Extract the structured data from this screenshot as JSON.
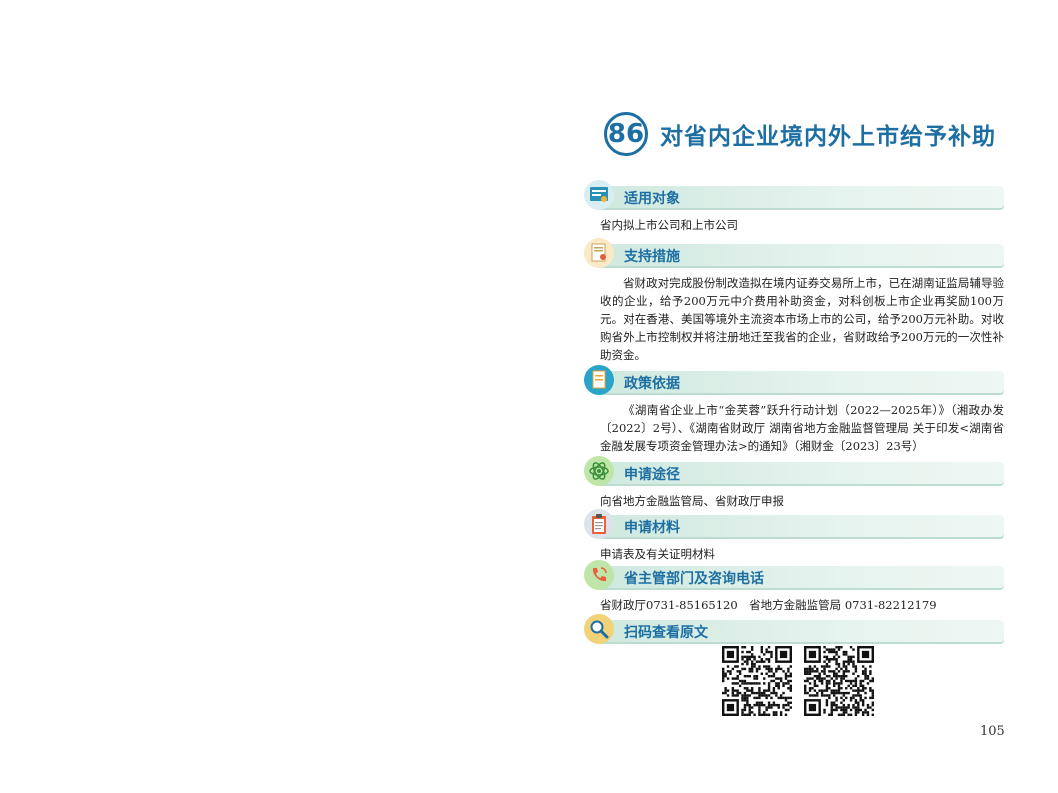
{
  "header": {
    "number": "86",
    "title": "对省内企业境内外上市给予补助"
  },
  "sections": [
    {
      "heading": "适用对象",
      "icon": "document-icon",
      "body": "省内拟上市公司和上市公司"
    },
    {
      "heading": "支持措施",
      "icon": "certificate-icon",
      "body": "省财政对完成股份制改造拟在境内证券交易所上市，已在湖南证监局辅导验收的企业，给予200万元中介费用补助资金，对科创板上市企业再奖励100万元。对在香港、美国等境外主流资本市场上市的公司，给予200万元补助。对收购省外上市控制权并将注册地迁至我省的企业，省财政给予200万元的一次性补助资金。"
    },
    {
      "heading": "政策依据",
      "icon": "policy-doc-icon",
      "body": "《湖南省企业上市“金芙蓉”跃升行动计划（2022—2025年）》（湘政办发〔2022〕2号）、《湖南省财政厅 湖南省地方金融监督管理局 关于印发<湖南省金融发展专项资金管理办法>的通知》（湘财金〔2023〕23号）"
    },
    {
      "heading": "申请途径",
      "icon": "atom-icon",
      "body": "向省地方金融监管局、省财政厅申报"
    },
    {
      "heading": "申请材料",
      "icon": "clipboard-icon",
      "body": "申请表及有关证明材料"
    },
    {
      "heading": "省主管部门及咨询电话",
      "icon": "phone-icon",
      "body": "省财政厅0731-85165120　省地方金融监管局 0731-82212179"
    },
    {
      "heading": "扫码查看原文",
      "icon": "magnifier-icon",
      "body": ""
    }
  ],
  "page_number": "105"
}
